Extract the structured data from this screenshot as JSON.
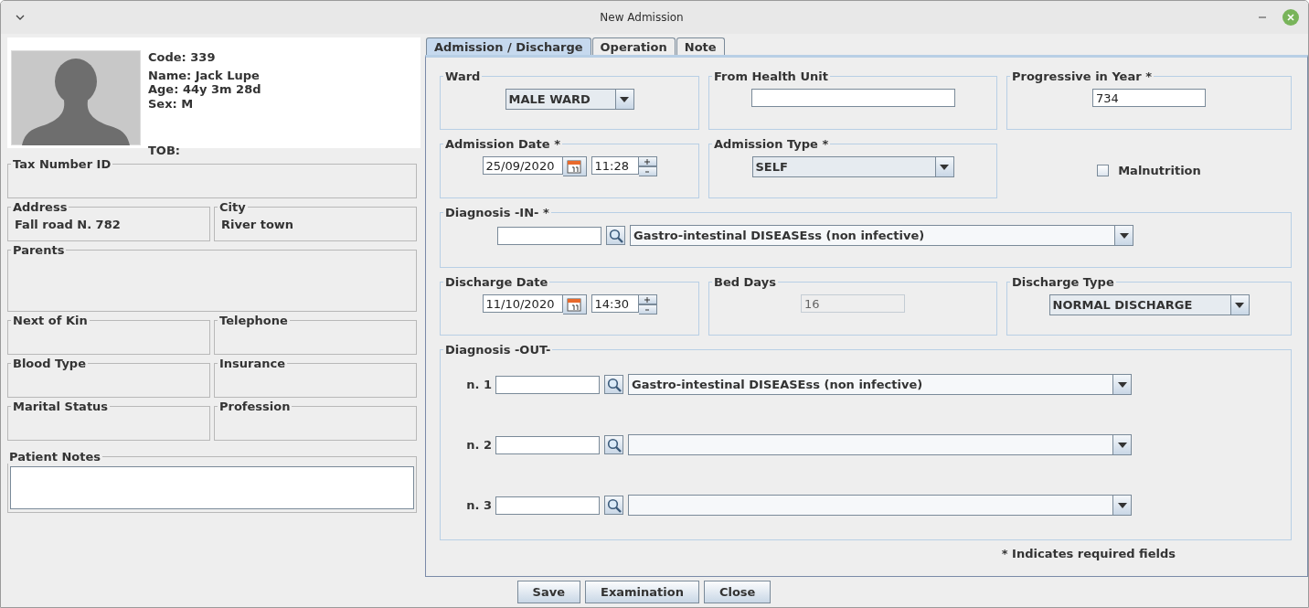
{
  "window": {
    "title": "New Admission"
  },
  "patient": {
    "code": "Code: 339",
    "name": "Name: Jack Lupe",
    "age": "Age: 44y 3m 28d",
    "sex": "Sex: M",
    "tob": "TOB:"
  },
  "patient_rows": [
    [
      {
        "label": "Tax Number ID"
      }
    ],
    [
      {
        "label": "Address",
        "value": "Fall road N. 782"
      },
      {
        "label": "City",
        "value": "River town"
      }
    ],
    [
      {
        "label": "Parents"
      }
    ],
    [
      {
        "label": "Next of Kin"
      },
      {
        "label": "Telephone"
      }
    ],
    [
      {
        "label": "Blood Type"
      },
      {
        "label": "Insurance"
      }
    ],
    [
      {
        "label": "Marital Status"
      },
      {
        "label": "Profession"
      }
    ]
  ],
  "patient_notes": {
    "label": "Patient Notes"
  },
  "tabs": [
    {
      "label": "Admission / Discharge",
      "selected": true
    },
    {
      "label": "Operation",
      "selected": false
    },
    {
      "label": "Note",
      "selected": false
    }
  ],
  "ward": {
    "label": "Ward",
    "value": "MALE WARD"
  },
  "from_health_unit": {
    "label": "From Health Unit"
  },
  "progressive_in_year": {
    "label": "Progressive in Year *",
    "value": "734"
  },
  "admission_date": {
    "label": "Admission Date *",
    "date": "25/09/2020",
    "time": "11:28"
  },
  "admission_type": {
    "label": "Admission Type *",
    "value": "SELF"
  },
  "malnutrition": {
    "label": "Malnutrition",
    "checked": false
  },
  "diagnosis_in": {
    "label": "Diagnosis -IN- *",
    "value": "Gastro-intestinal DISEASEss (non infective)"
  },
  "discharge_date": {
    "label": "Discharge Date",
    "date": "11/10/2020",
    "time": "14:30"
  },
  "bed_days": {
    "label": "Bed Days",
    "value": "16",
    "disabled": true
  },
  "discharge_type": {
    "label": "Discharge Type",
    "value": "NORMAL DISCHARGE"
  },
  "diagnosis_out": {
    "label": "Diagnosis -OUT-",
    "rows": [
      {
        "label": "n. 1",
        "value": "Gastro-intestinal DISEASEss (non infective)"
      },
      {
        "label": "n. 2"
      },
      {
        "label": "n. 3"
      }
    ]
  },
  "required_note": "* Indicates required fields",
  "buttons": [
    "Save",
    "Examination",
    "Close"
  ]
}
